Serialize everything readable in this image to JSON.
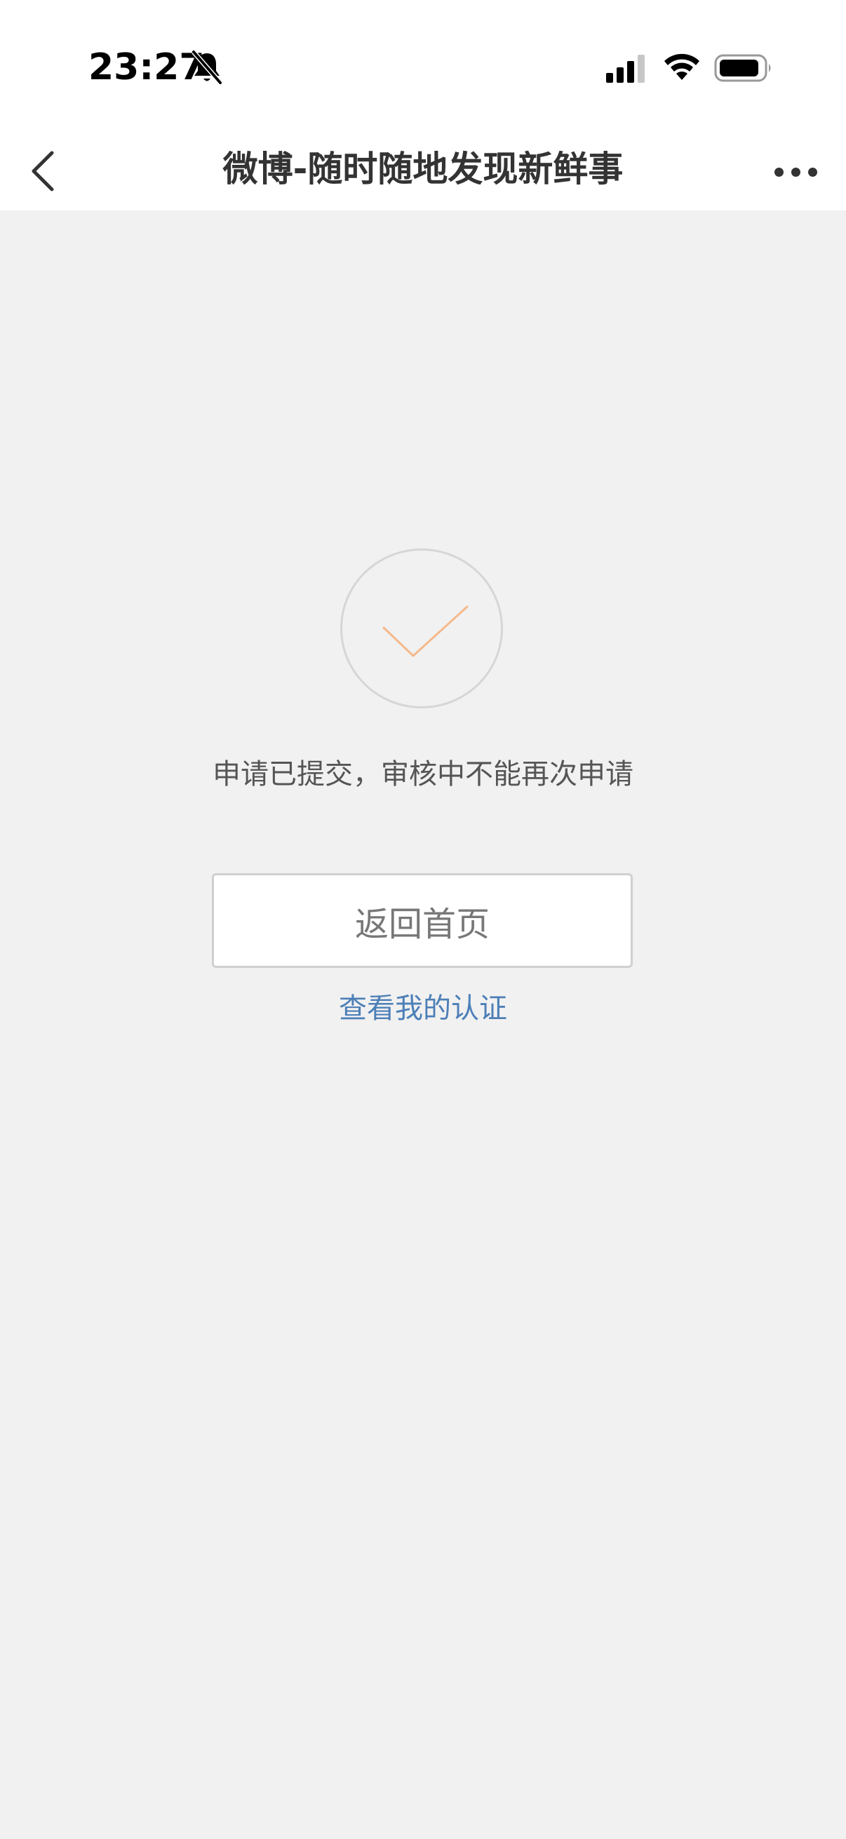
{
  "status_bar": {
    "time": "23:27",
    "icons": [
      "bell-muted-icon",
      "cellular-signal-icon",
      "wifi-icon",
      "battery-icon"
    ]
  },
  "nav": {
    "title": "微博-随时随地发现新鲜事",
    "back_icon": "chevron-left-icon",
    "more_icon": "more-dots-icon"
  },
  "main": {
    "status_icon": "checkmark-icon",
    "message": "申请已提交，审核中不能再次申请",
    "home_button_label": "返回首页",
    "cert_link_label": "查看我的认证"
  },
  "colors": {
    "background": "#f1f1f1",
    "checkmark": "#f5b98b",
    "link": "#4d7fb7",
    "title": "#333333"
  }
}
